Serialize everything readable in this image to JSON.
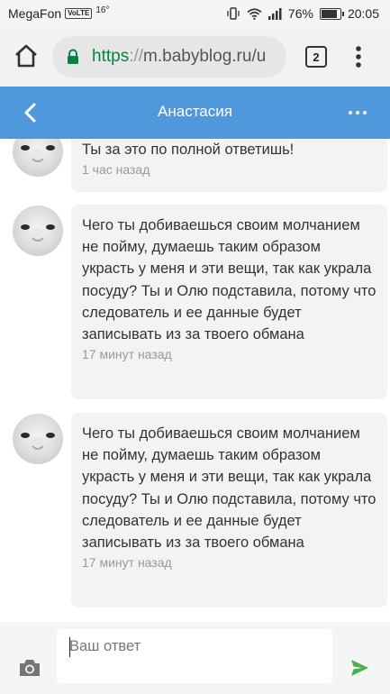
{
  "status_bar": {
    "carrier": "MegaFon",
    "volte": "VoLTE",
    "temperature": "16°",
    "battery_percent": "76%",
    "battery_level": 0.76,
    "time": "20:05"
  },
  "browser": {
    "url_scheme": "https",
    "url_separator": "://",
    "url_host": "m.babyblog.ru/u",
    "tab_count": "2"
  },
  "header": {
    "title": "Анастасия"
  },
  "messages": [
    {
      "text": "Ты за это по полной ответишь!",
      "time": "1 час назад"
    },
    {
      "text": "Чего ты добиваешься своим молчанием не пойму, думаешь таким образом украсть у меня и эти вещи, так как украла посуду? Ты и Олю подставила, потому что следователь и ее данные будет записывать из за твоего обмана",
      "time": "17 минут назад"
    },
    {
      "text": "Чего ты добиваешься своим молчанием не пойму, думаешь таким образом украсть у меня и эти вещи, так как украла посуду? Ты и Олю подставила, потому что следователь и ее данные будет записывать из за твоего обмана",
      "time": "17 минут назад"
    }
  ],
  "composer": {
    "placeholder": "Ваш ответ"
  },
  "colors": {
    "header_bg": "#4f98dc",
    "bubble_bg": "#f3f3f3",
    "time_text": "#999999",
    "send_icon": "#4caf50",
    "lock_icon": "#0b8043"
  },
  "icons": {
    "home": "home-icon",
    "lock": "lock-icon",
    "back": "chevron-left-icon",
    "more": "more-horizontal-icon",
    "camera": "camera-icon",
    "send": "send-icon"
  }
}
